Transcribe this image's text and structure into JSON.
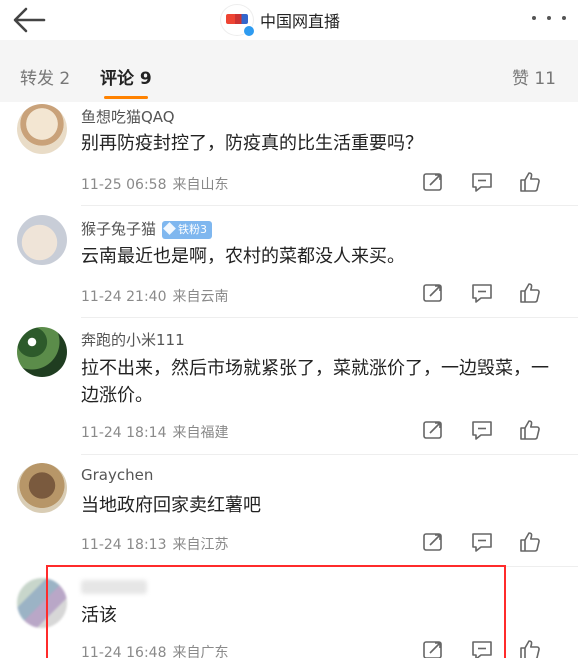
{
  "header": {
    "title": "中国网直播",
    "back_icon": "back-arrow-icon",
    "more_icon": "more-dots-icon"
  },
  "tabs": {
    "reposts": "转发 2",
    "comments": "评论 9",
    "likes": "赞 11"
  },
  "comments": [
    {
      "username": "鱼想吃猫QAQ",
      "text": "别再防疫封控了，防疫真的比生活重要吗？",
      "time": "11-25 06:58",
      "source": "来自山东"
    },
    {
      "username": "猴子兔子猫",
      "badge": "铁粉3",
      "text": "云南最近也是啊，农村的菜都没人来买。",
      "time": "11-24 21:40",
      "source": "来自云南"
    },
    {
      "username": "奔跑的小米111",
      "text": "拉不出来，然后市场就紧张了，菜就涨价了，一边毁菜，一边涨价。",
      "time": "11-24 18:14",
      "source": "来自福建"
    },
    {
      "username": "Graychen",
      "text": "当地政府回家卖红薯吧",
      "time": "11-24 18:13",
      "source": "来自江苏"
    },
    {
      "username": "",
      "text": "活该",
      "time": "11-24 16:48",
      "source": "来自广东"
    }
  ],
  "colors": {
    "accent": "#ff8200",
    "highlight_box": "#ff2b2b",
    "badge": "#7fb7ef"
  }
}
